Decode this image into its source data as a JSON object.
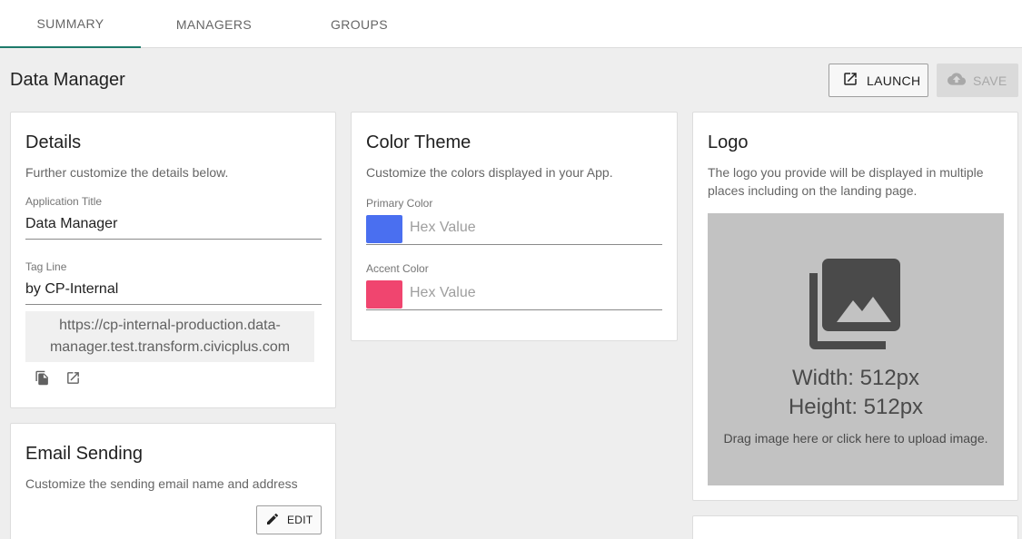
{
  "tabs": [
    {
      "label": "SUMMARY",
      "active": true
    },
    {
      "label": "MANAGERS",
      "active": false
    },
    {
      "label": "GROUPS",
      "active": false
    }
  ],
  "page": {
    "title": "Data Manager",
    "launch_label": "LAUNCH",
    "save_label": "SAVE"
  },
  "details": {
    "title": "Details",
    "subtitle": "Further customize the details below.",
    "app_title_label": "Application Title",
    "app_title_value": "Data Manager",
    "tagline_label": "Tag Line",
    "tagline_value": "by CP-Internal",
    "url_line1": "https://cp-internal-production.data-",
    "url_line2": "manager.test.transform.civicplus.com"
  },
  "color_theme": {
    "title": "Color Theme",
    "subtitle": "Customize the colors displayed in your App.",
    "primary_label": "Primary Color",
    "primary_color": "#4a6ff0",
    "primary_placeholder": "Hex Value",
    "accent_label": "Accent Color",
    "accent_color": "#f0456f",
    "accent_placeholder": "Hex Value"
  },
  "logo": {
    "title": "Logo",
    "subtitle_line1": "The logo you provide will be displayed in multiple",
    "subtitle_line2": "places including on the landing page.",
    "width_text": "Width: 512px",
    "height_text": "Height: 512px",
    "drop_hint": "Drag image here or click here to upload image.",
    "icon": "image-library-icon"
  },
  "email": {
    "title": "Email Sending",
    "subtitle": "Customize the sending email name and address",
    "edit_label": "EDIT"
  },
  "colors": {
    "active_tab_underline": "#1d7a6a",
    "background": "#eeeeee",
    "logo_dropzone": "#c2c2c2"
  }
}
